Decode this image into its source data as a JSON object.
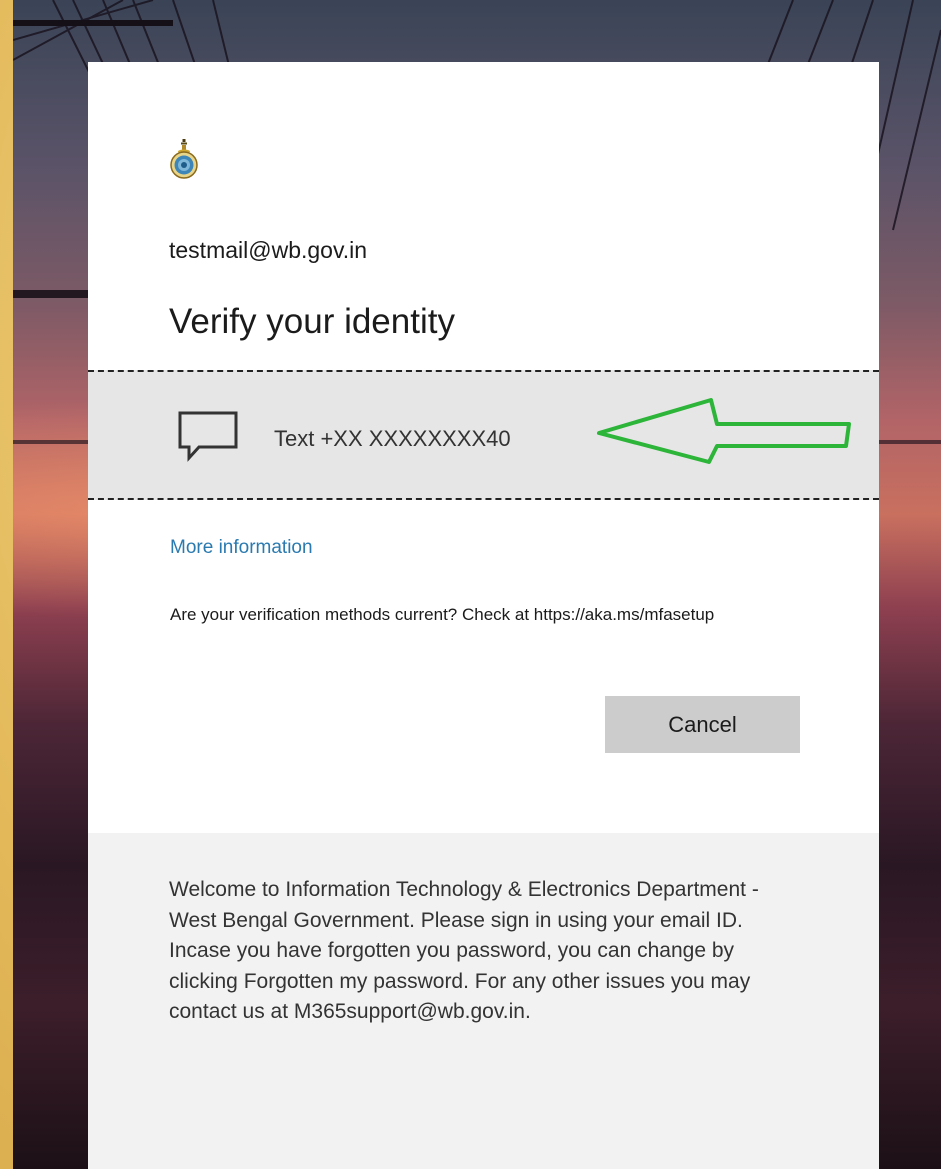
{
  "account": {
    "email": "testmail@wb.gov.in"
  },
  "page": {
    "title": "Verify your identity"
  },
  "methods": [
    {
      "label": "Text +XX XXXXXXXX40",
      "icon": "chat-bubble-icon"
    }
  ],
  "links": {
    "more_info": "More information"
  },
  "notes": {
    "verification_methods": "Are your verification methods current? Check at https://aka.ms/mfasetup"
  },
  "buttons": {
    "cancel": "Cancel"
  },
  "footer": {
    "text": "Welcome to Information Technology & Electronics Department - West Bengal Government. Please sign in using your email ID. Incase you have forgotten you password, you can change by clicking Forgotten my password. For any other issues you may contact us at M365support@wb.gov.in."
  },
  "colors": {
    "link": "#2a7ab0",
    "button_bg": "#cccccc",
    "highlight_row": "#e6e6e6",
    "annotation_arrow": "#2db53a",
    "footer_bg": "#f2f2f2"
  },
  "icons": [
    "government-emblem-icon",
    "chat-bubble-icon",
    "annotation-arrow-icon"
  ]
}
